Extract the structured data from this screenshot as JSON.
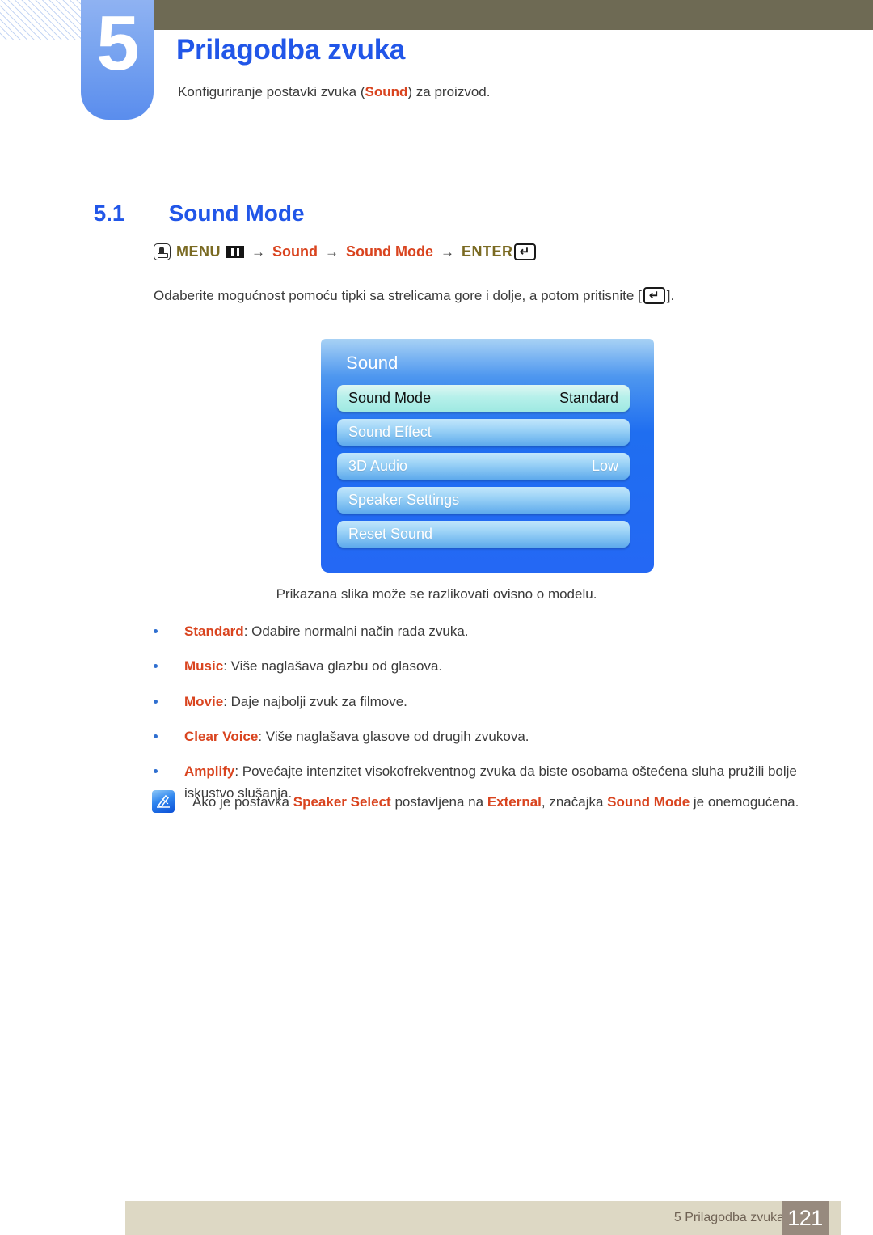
{
  "chapter": {
    "number": "5",
    "title": "Prilagodba zvuka",
    "description_before": "Konfiguriranje postavki zvuka (",
    "description_accent": "Sound",
    "description_after": ") za proizvod."
  },
  "section": {
    "number": "5.1",
    "title": "Sound Mode"
  },
  "menu_path": {
    "press_icon": "press-button-icon",
    "menu_label": "MENU",
    "menu_bars_icon": "menu-bars-icon",
    "arrow": "→",
    "item1": "Sound",
    "item2": "Sound Mode",
    "enter_label": "ENTER",
    "enter_icon": "enter-key-icon"
  },
  "instruction": {
    "before": "Odaberite mogućnost pomoću tipki sa strelicama gore i dolje, a potom pritisnite [",
    "after": "]."
  },
  "osd": {
    "title": "Sound",
    "rows": [
      {
        "label": "Sound Mode",
        "value": "Standard",
        "selected": true
      },
      {
        "label": "Sound Effect",
        "value": "",
        "selected": false
      },
      {
        "label": "3D Audio",
        "value": "Low",
        "selected": false
      },
      {
        "label": "Speaker Settings",
        "value": "",
        "selected": false
      },
      {
        "label": "Reset Sound",
        "value": "",
        "selected": false
      }
    ],
    "caption": "Prikazana slika može se razlikovati ovisno o modelu."
  },
  "bullets": [
    {
      "term": "Standard",
      "text": ": Odabire normalni način rada zvuka."
    },
    {
      "term": "Music",
      "text": ": Više naglašava glazbu od glasova."
    },
    {
      "term": "Movie",
      "text": ": Daje najbolji zvuk za filmove."
    },
    {
      "term": "Clear Voice",
      "text": ": Više naglašava glasove od drugih zvukova."
    },
    {
      "term": "Amplify",
      "text": ": Povećajte intenzitet visokofrekventnog zvuka da biste osobama oštećena sluha pružili bolje iskustvo slušanja."
    }
  ],
  "note": {
    "icon": "note-pencil-icon",
    "part1": "Ako je postavka ",
    "term1": "Speaker Select",
    "part2": " postavljena na ",
    "term2": "External",
    "part3": ", značajka ",
    "term3": "Sound Mode",
    "part4": " je onemogućena."
  },
  "footer": {
    "text": "5 Prilagodba zvuka",
    "page": "121"
  },
  "colors": {
    "heading_blue": "#2156e8",
    "accent_red": "#d9441f",
    "olive": "#6e6a54",
    "menu_olive": "#7a6a22",
    "footer_bar": "#ddd8c4",
    "footer_page_box": "#978a7e"
  }
}
